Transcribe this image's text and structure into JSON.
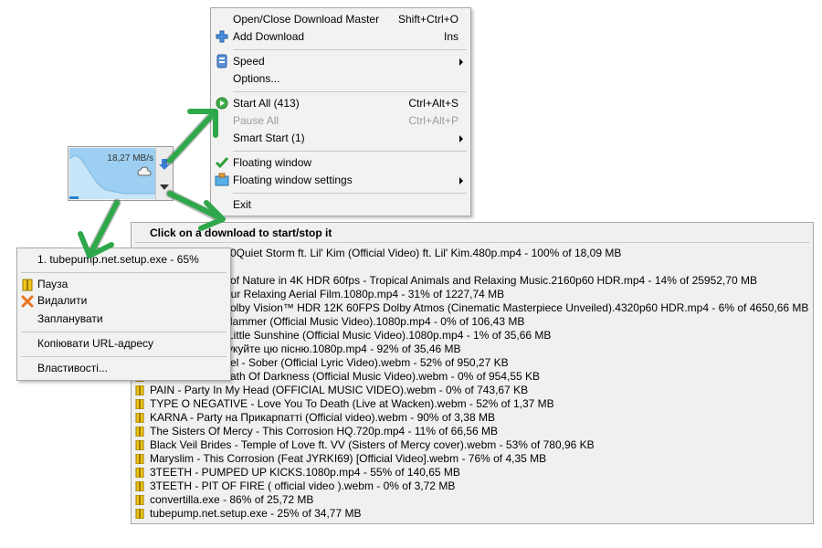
{
  "main_menu": {
    "items": [
      {
        "label": "Open/Close Download Master",
        "shortcut": "Shift+Ctrl+O"
      },
      {
        "label": "Add Download",
        "shortcut": "Ins"
      },
      {
        "label": "Speed",
        "shortcut": ""
      },
      {
        "label": "Options...",
        "shortcut": ""
      },
      {
        "label": "Start All (413)",
        "shortcut": "Ctrl+Alt+S"
      },
      {
        "label": "Pause All",
        "shortcut": "Ctrl+Alt+P"
      },
      {
        "label": "Smart Start (1)",
        "shortcut": ""
      },
      {
        "label": "Floating window",
        "shortcut": ""
      },
      {
        "label": "Floating window settings",
        "shortcut": ""
      },
      {
        "label": "Exit",
        "shortcut": ""
      }
    ]
  },
  "floating_window": {
    "speed": "18,27 MB/s"
  },
  "downloads_panel": {
    "header": "Click on a download to start/stop it",
    "rows": [
      "0Quiet Storm ft. Lil' Kim (Official Video) ft. Lil' Kim.480p.mp4 - 100% of 18,09 MB",
      "of Nature in 4K HDR 60fps - Tropical Animals and Relaxing Music.2160p60 HDR.mp4 - 14% of 25952,70 MB",
      "our Relaxing Aerial Film.1080p.mp4 - 31% of 1227,74 MB",
      "olby Vision™ HDR 12K 60FPS Dolby Atmos (Cinematic Masterpiece Unveiled).4320p60 HDR.mp4 - 6% of 4650,66 MB",
      "Hammer (Official Music Video).1080p.mp4 - 0% of 106,43 MB",
      "Little Sunshine (Official Music Video).1080p.mp4 - 1% of 35,66 MB",
      "укуйте цю пісню.1080p.mp4 - 92% of 35,46 MB",
      "el - Sober (Official Lyric Video).webm - 52% of 950,27 KB",
      "ath Of Darkness (Official Music Video).webm - 0% of 954,55 KB",
      "PAIN - Party In My Head (OFFICIAL MUSIC VIDEO).webm - 0% of 743,67 KB",
      "TYPE O NEGATIVE - Love You To Death (Live at Wacken).webm - 52% of 1,37 MB",
      "KARNA - Party на Прикарпатті (Official video).webm - 90% of 3,38 MB",
      "The Sisters Of Mercy - This Corrosion HQ.720p.mp4 - 11% of 66,56 MB",
      "Black Veil Brides - Temple of Love ft. VV (Sisters of Mercy cover).webm - 53% of 780,96 KB",
      "Maryslim - This Corrosion (Feat JYRKI69) [Official Video].webm - 76% of 4,35 MB",
      "3TEETH - PUMPED UP KICKS.1080p.mp4 - 55% of 140,65 MB",
      "3TEETH - PIT OF FIRE ( official video ).webm - 0% of 3,72 MB",
      "convertilla.exe - 86% of 25,72 MB",
      "tubepump.net.setup.exe - 25% of 34,77 MB"
    ]
  },
  "tray_menu": {
    "title": "1. tubepump.net.setup.exe - 65%",
    "items": [
      "Пауза",
      "Видалити",
      "Запланувати",
      "Копіювати URL-адресу",
      "Властивості..."
    ]
  },
  "colors": {
    "arrow_green": "#2ea84a",
    "graph_blue": "#9ccff1"
  }
}
